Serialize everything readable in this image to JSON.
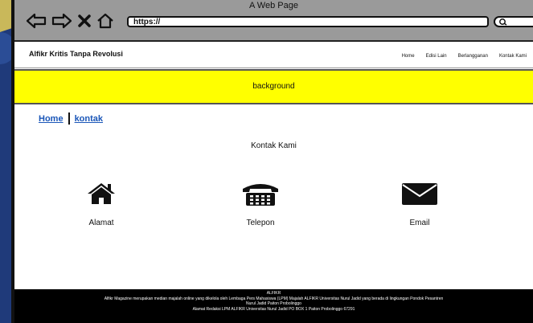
{
  "window": {
    "title": "A Web Page"
  },
  "toolbar": {
    "url": "https://",
    "back_icon": "back-arrow-icon",
    "forward_icon": "forward-arrow-icon",
    "close_icon": "close-icon",
    "home_icon": "home-icon",
    "search_icon": "search-icon"
  },
  "header": {
    "brand": "Alfikr Kritis Tanpa Revolusi",
    "menu": [
      "Home",
      "Edisi Lain",
      "Berlangganan",
      "Kontak Kami"
    ]
  },
  "banner": {
    "text": "background",
    "color": "#ffff00"
  },
  "breadcrumb": {
    "home": "Home",
    "current": "kontak"
  },
  "contact": {
    "title": "Kontak Kami",
    "items": [
      {
        "label": "Alamat",
        "icon": "house-icon"
      },
      {
        "label": "Telepon",
        "icon": "telephone-icon"
      },
      {
        "label": "Email",
        "icon": "envelope-icon"
      }
    ]
  },
  "footer": {
    "title": "ALFIKR",
    "line1": "Alfikr Magazine merupakan median majalah online yang dikelola oleh Lembaga Pers Mahasiswa (LPM) Majalah ALFIKR Universitas Nurul Jadid yang berada di lingkungan Pondok Pesantren",
    "line2": "Nurul Jadid Paiton Probolinggo",
    "line3": "Alamat Redaksi LPM ALFIKR Universitas Nurul Jadid PO BOX 1 Paiton Probolinggo 67291"
  }
}
